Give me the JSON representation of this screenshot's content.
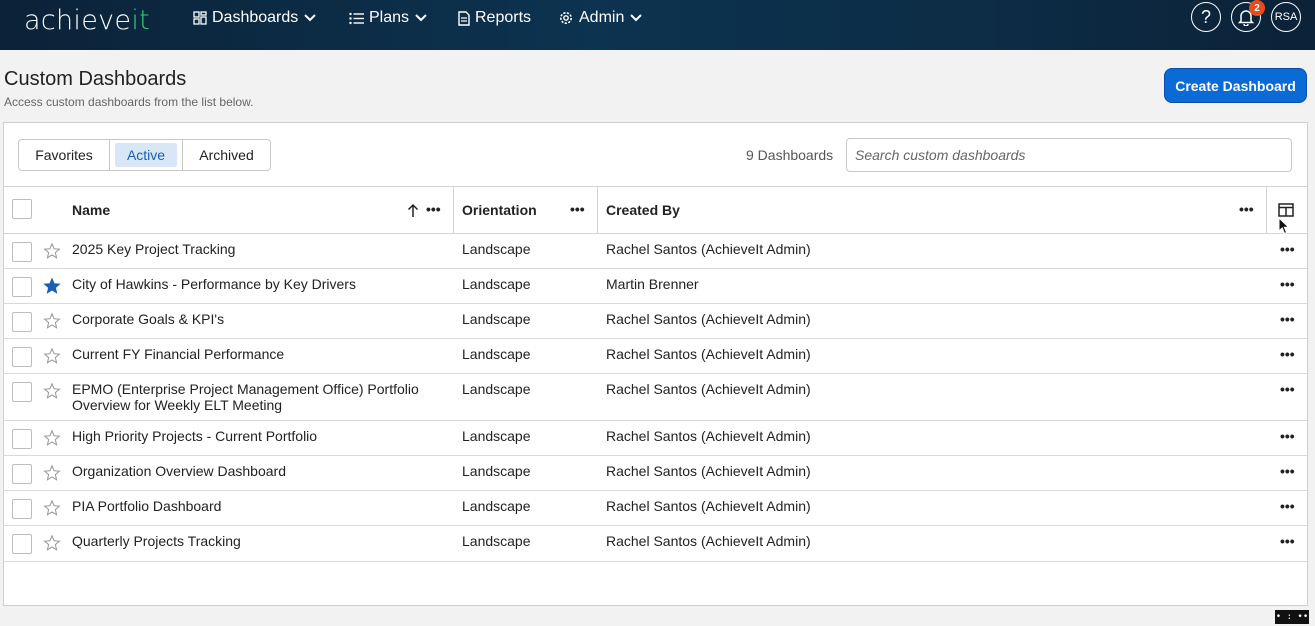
{
  "nav": {
    "logo_main": "achieve",
    "logo_accent": "it",
    "items": [
      {
        "label": "Dashboards"
      },
      {
        "label": "Plans"
      },
      {
        "label": "Reports"
      },
      {
        "label": "Admin"
      }
    ],
    "help_symbol": "?",
    "notification_count": "2",
    "avatar_initials": "RSA"
  },
  "page": {
    "title": "Custom Dashboards",
    "subtitle": "Access custom dashboards from the list below.",
    "create_button": "Create Dashboard"
  },
  "filters": {
    "tabs": [
      {
        "label": "Favorites",
        "selected": false
      },
      {
        "label": "Active",
        "selected": true
      },
      {
        "label": "Archived",
        "selected": false
      }
    ],
    "count_label": "9 Dashboards",
    "search_placeholder": "Search custom dashboards"
  },
  "table": {
    "columns": [
      {
        "label": "Name",
        "sort": "ascending"
      },
      {
        "label": "Orientation"
      },
      {
        "label": "Created By"
      }
    ],
    "rows": [
      {
        "name": "2025 Key Project Tracking",
        "orientation": "Landscape",
        "created_by": "Rachel Santos (AchieveIt Admin)",
        "favorite": false
      },
      {
        "name": "City of Hawkins - Performance by Key Drivers",
        "orientation": "Landscape",
        "created_by": "Martin Brenner",
        "favorite": true
      },
      {
        "name": "Corporate Goals & KPI's",
        "orientation": "Landscape",
        "created_by": "Rachel Santos (AchieveIt Admin)",
        "favorite": false
      },
      {
        "name": "Current FY Financial Performance",
        "orientation": "Landscape",
        "created_by": "Rachel Santos (AchieveIt Admin)",
        "favorite": false
      },
      {
        "name": "EPMO (Enterprise Project Management Office) Portfolio Overview for Weekly ELT Meeting",
        "orientation": "Landscape",
        "created_by": "Rachel Santos (AchieveIt Admin)",
        "favorite": false
      },
      {
        "name": "High Priority Projects - Current Portfolio",
        "orientation": "Landscape",
        "created_by": "Rachel Santos (AchieveIt Admin)",
        "favorite": false
      },
      {
        "name": "Organization Overview Dashboard",
        "orientation": "Landscape",
        "created_by": "Rachel Santos (AchieveIt Admin)",
        "favorite": false
      },
      {
        "name": "PIA Portfolio Dashboard",
        "orientation": "Landscape",
        "created_by": "Rachel Santos (AchieveIt Admin)",
        "favorite": false
      },
      {
        "name": "Quarterly Projects Tracking",
        "orientation": "Landscape",
        "created_by": "Rachel Santos (AchieveIt Admin)",
        "favorite": false
      }
    ]
  },
  "colors": {
    "nav_bg": "#0c3350",
    "accent": "#0a6ad6",
    "logo_accent": "#2ecc71",
    "favorite_star": "#1a5fb4",
    "badge": "#e74c1c"
  },
  "icons": [
    "dashboards-grid-icon",
    "list-icon",
    "document-icon",
    "gear-icon",
    "chevron-down-icon",
    "help-icon",
    "bell-icon",
    "sort-up-arrow-icon",
    "more-dots-icon",
    "columns-icon",
    "star-icon",
    "cursor-icon"
  ]
}
